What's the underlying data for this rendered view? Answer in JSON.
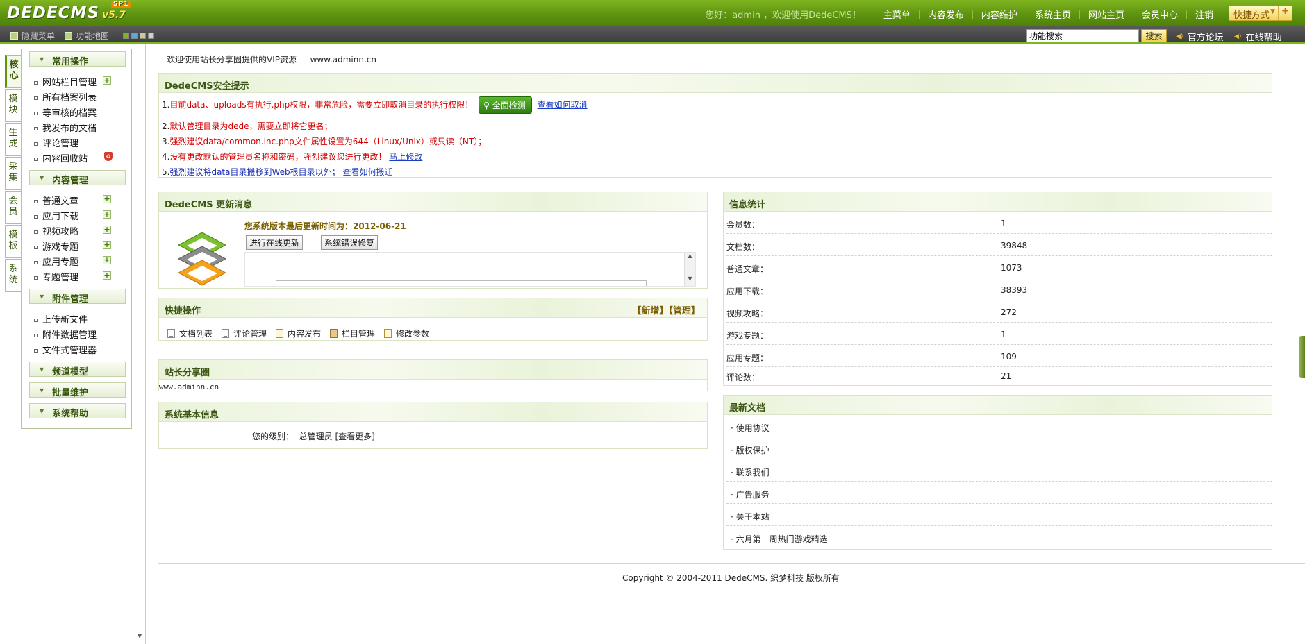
{
  "header": {
    "logo_text": "DEDECMS",
    "logo_version": "v5.7",
    "logo_badge": "SP1",
    "greeting": "您好：admin ，欢迎使用DedeCMS！",
    "nav": [
      "主菜单",
      "内容发布",
      "内容维护",
      "系统主页",
      "网站主页",
      "会员中心",
      "注销"
    ],
    "shortcut_label": "快捷方式"
  },
  "toolbar": {
    "hide_menu": "隐藏菜单",
    "func_map": "功能地图",
    "skin_colors": [
      "#7fb520",
      "#5aa7d8",
      "#c8c8a0",
      "#d0d0d0"
    ],
    "search_value": "功能搜索",
    "search_button": "搜索",
    "forum_link": "官方论坛",
    "help_link": "在线帮助"
  },
  "vtabs": [
    "核心",
    "模块",
    "生成",
    "采集",
    "会员",
    "模板",
    "系统"
  ],
  "menu": {
    "groups": [
      {
        "title": "常用操作",
        "items": [
          "网站栏目管理",
          "所有档案列表",
          "等审核的档案",
          "我发布的文档",
          "评论管理",
          "内容回收站"
        ]
      },
      {
        "title": "内容管理",
        "items": [
          "普通文章",
          "应用下载",
          "视频攻略",
          "游戏专题",
          "应用专题",
          "专题管理"
        ]
      },
      {
        "title": "附件管理",
        "items": [
          "上传新文件",
          "附件数据管理",
          "文件式管理器"
        ]
      },
      {
        "title": "频道模型",
        "items": []
      },
      {
        "title": "批量维护",
        "items": []
      },
      {
        "title": "系统帮助",
        "items": []
      }
    ]
  },
  "main": {
    "welcome": "欢迎使用站长分享圈提供的VIP资源 — www.adminn.cn",
    "security": {
      "title": "DedeCMS安全提示",
      "lines": [
        {
          "num": "1.",
          "text": "目前data、uploads有执行.php权限，非常危险，需要立即取消目录的执行权限！",
          "button": "全面检测",
          "link": "查看如何取消"
        },
        {
          "num": "2.",
          "text": "默认管理目录为dede，需要立即将它更名；"
        },
        {
          "num": "3.",
          "text": "强烈建议data/common.inc.php文件属性设置为644（Linux/Unix）或只读（NT）；"
        },
        {
          "num": "4.",
          "text": "没有更改默认的管理员名称和密码，强烈建议您进行更改！",
          "link": "马上修改"
        },
        {
          "num": "5.",
          "text": "强烈建议将data目录搬移到Web根目录以外；",
          "link": "查看如何搬迁"
        }
      ]
    },
    "update": {
      "title": "DedeCMS 更新消息",
      "last_update": "您系统版本最后更新时间为：2012-06-21",
      "btn_online": "进行在线更新",
      "btn_repair": "系统错误修复"
    },
    "quick": {
      "title": "快捷操作",
      "right": "【新增】【管理】",
      "items": [
        "文档列表",
        "评论管理",
        "内容发布",
        "栏目管理",
        "修改参数"
      ]
    },
    "share": {
      "title": "站长分享圈",
      "text": "www.adminn.cn"
    },
    "sysinfo": {
      "title": "系统基本信息",
      "level_label": "您的级别：",
      "level_value": "总管理员",
      "more": "[查看更多]"
    },
    "stats": {
      "title": "信息统计",
      "rows": [
        {
          "k": "会员数：",
          "v": "1"
        },
        {
          "k": "文档数：",
          "v": "39848"
        },
        {
          "k": "普通文章：",
          "v": "1073"
        },
        {
          "k": "应用下载：",
          "v": "38393"
        },
        {
          "k": "视频攻略：",
          "v": "272"
        },
        {
          "k": "游戏专题：",
          "v": "1"
        },
        {
          "k": "应用专题：",
          "v": "109"
        },
        {
          "k": "评论数：",
          "v": "21"
        }
      ]
    },
    "latest": {
      "title": "最新文档",
      "items": [
        "· 使用协议",
        "· 版权保护",
        "· 联系我们",
        "· 广告服务",
        "· 关于本站",
        "· 六月第一周热门游戏精选"
      ]
    },
    "footer": {
      "prefix": "Copyright © 2004-2011 ",
      "brand": "DedeCMS",
      "suffix": ". 织梦科技 版权所有"
    }
  }
}
